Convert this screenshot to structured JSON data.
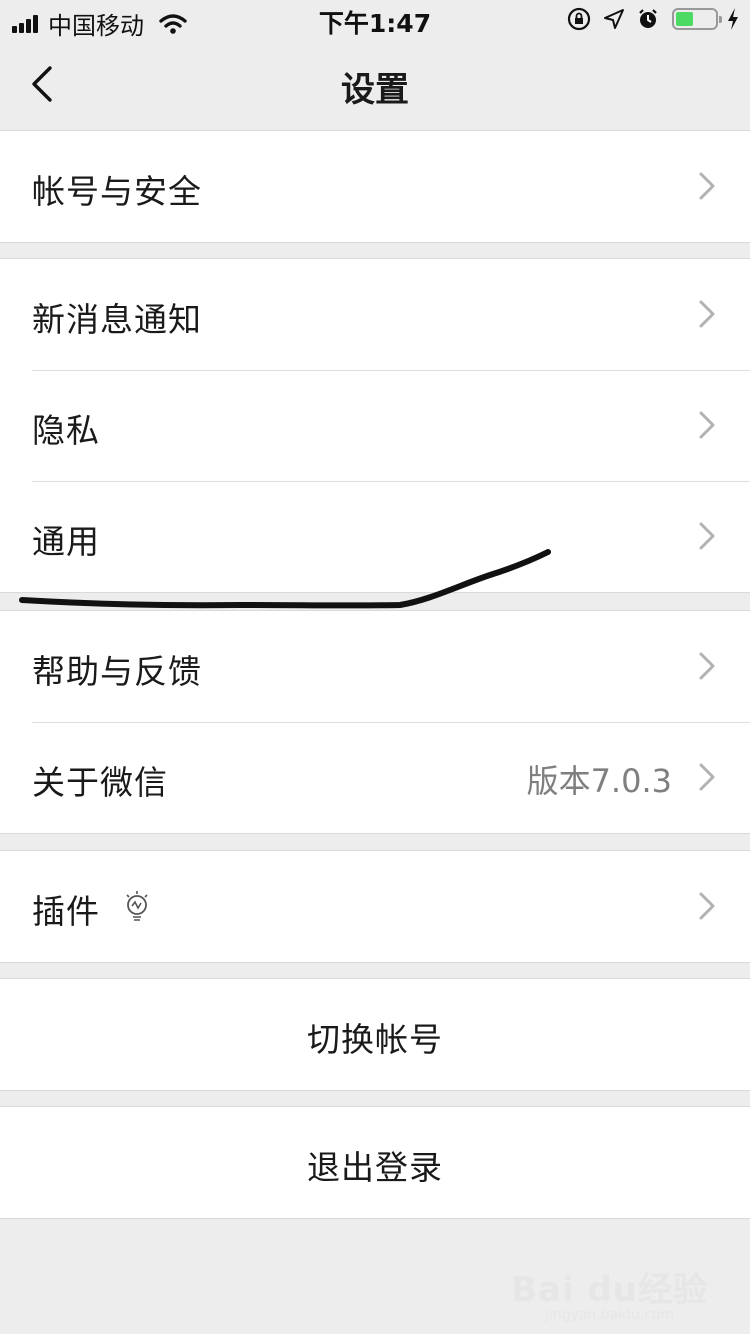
{
  "status_bar": {
    "carrier": "中国移动",
    "time": "下午1:47",
    "battery_level": 0.45,
    "icons": [
      "signal-icon",
      "wifi-icon",
      "orientation-lock-icon",
      "location-icon",
      "alarm-icon",
      "battery-icon",
      "charging-icon"
    ]
  },
  "nav": {
    "title": "设置",
    "back_icon": "chevron-left-icon"
  },
  "groups": [
    {
      "items": [
        {
          "label": "帐号与安全"
        }
      ]
    },
    {
      "items": [
        {
          "label": "新消息通知"
        },
        {
          "label": "隐私"
        },
        {
          "label": "通用"
        }
      ]
    },
    {
      "items": [
        {
          "label": "帮助与反馈"
        },
        {
          "label": "关于微信",
          "value": "版本7.0.3"
        }
      ]
    },
    {
      "items": [
        {
          "label": "插件",
          "icon": "lightbulb-icon"
        }
      ]
    }
  ],
  "actions": {
    "switch_account": "切换帐号",
    "logout": "退出登录"
  },
  "watermark": {
    "main": "Bai du经验",
    "sub": "jingyan.baidu.com"
  },
  "colors": {
    "background": "#ededed",
    "cell": "#ffffff",
    "secondary_text": "#7f7f7f",
    "battery_fill": "#4cd964"
  }
}
